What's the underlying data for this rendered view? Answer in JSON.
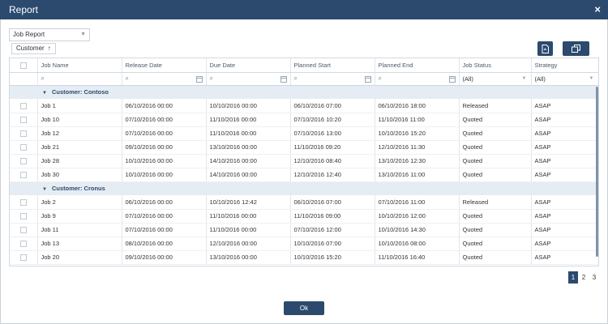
{
  "window": {
    "title": "Report",
    "close_glyph": "×"
  },
  "toolbar": {
    "report_select": {
      "value": "Job Report"
    },
    "group_chip": {
      "label": "Customer",
      "sort_glyph": "↑"
    },
    "export_icon": "document-export-icon",
    "copy_icon": "copy-icon"
  },
  "grid": {
    "columns": [
      "",
      "Job Name",
      "Release Date",
      "Due Date",
      "Planned Start",
      "Planned End",
      "Job Status",
      "Strategy"
    ],
    "filters": {
      "job_status": "(All)",
      "strategy": "(All)"
    },
    "groups": [
      {
        "label": "Customer: Contoso",
        "rows": [
          [
            "Job 1",
            "06/10/2016 00:00",
            "10/10/2016 00:00",
            "06/10/2016 07:00",
            "06/10/2016 18:00",
            "Released",
            "ASAP"
          ],
          [
            "Job 10",
            "07/10/2016 00:00",
            "11/10/2016 00:00",
            "07/10/2016 10:20",
            "11/10/2016 11:00",
            "Quoted",
            "ASAP"
          ],
          [
            "Job 12",
            "07/10/2016 00:00",
            "11/10/2016 00:00",
            "07/10/2016 13:00",
            "10/10/2016 15:20",
            "Quoted",
            "ASAP"
          ],
          [
            "Job 21",
            "09/10/2016 00:00",
            "13/10/2016 00:00",
            "11/10/2016 09:20",
            "12/10/2016 11:30",
            "Quoted",
            "ASAP"
          ],
          [
            "Job 28",
            "10/10/2016 00:00",
            "14/10/2016 00:00",
            "12/10/2016 08:40",
            "13/10/2016 12:30",
            "Quoted",
            "ASAP"
          ],
          [
            "Job 30",
            "10/10/2016 00:00",
            "14/10/2016 00:00",
            "12/10/2016 12:40",
            "13/10/2016 11:00",
            "Quoted",
            "ASAP"
          ]
        ]
      },
      {
        "label": "Customer: Cronus",
        "rows": [
          [
            "Job 2",
            "06/10/2016 00:00",
            "10/10/2016 12:42",
            "06/10/2016 07:00",
            "07/10/2016 11:00",
            "Released",
            "ASAP"
          ],
          [
            "Job 9",
            "07/10/2016 00:00",
            "11/10/2016 00:00",
            "11/10/2016 09:00",
            "10/10/2016 12:00",
            "Quoted",
            "ASAP"
          ],
          [
            "Job 11",
            "07/10/2016 00:00",
            "11/10/2016 00:00",
            "07/10/2016 12:00",
            "10/10/2016 14:30",
            "Quoted",
            "ASAP"
          ],
          [
            "Job 13",
            "08/10/2016 00:00",
            "12/10/2016 00:00",
            "10/10/2016 07:00",
            "10/10/2016 08:00",
            "Quoted",
            "ASAP"
          ],
          [
            "Job 20",
            "09/10/2016 00:00",
            "13/10/2016 00:00",
            "10/10/2016 15:20",
            "11/10/2016 16:40",
            "Quoted",
            "ASAP"
          ]
        ]
      }
    ]
  },
  "pagination": {
    "pages": [
      "1",
      "2",
      "3"
    ],
    "current": "1"
  },
  "footer": {
    "ok_label": "Ok"
  },
  "colors": {
    "primary": "#2b4a6e",
    "group_bg": "#e6ecf3"
  }
}
